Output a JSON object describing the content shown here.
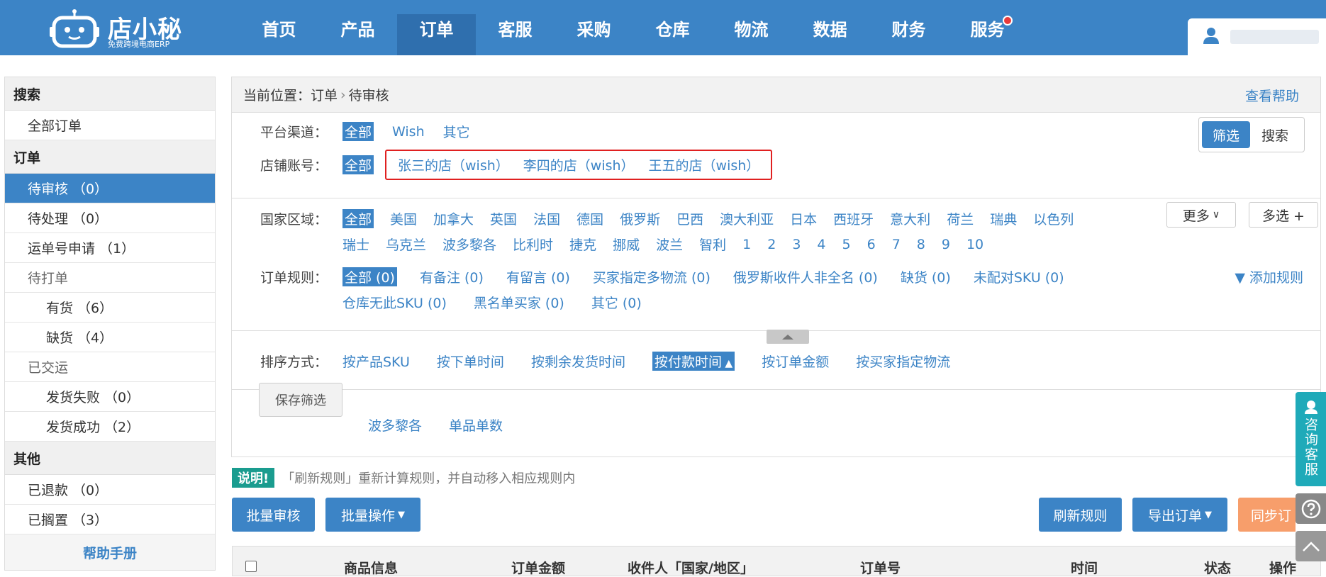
{
  "brand": {
    "name": "店小秘",
    "tagline": "免费跨境电商ERP"
  },
  "nav": {
    "items": [
      "首页",
      "产品",
      "订单",
      "客服",
      "采购",
      "仓库",
      "物流",
      "数据",
      "财务",
      "服务"
    ],
    "active_index": 2,
    "dot_on": "服务"
  },
  "sidebar": {
    "search_head": "搜索",
    "all_orders": "全部订单",
    "order_head": "订单",
    "pending_review": "待审核 （0）",
    "pending": "待处理 （0）",
    "tracking_apply": "运单号申请 （1）",
    "to_print": "待打单",
    "in_stock": "有货 （6）",
    "out_stock": "缺货 （4）",
    "shipped": "已交运",
    "ship_fail": "发货失败 （0）",
    "ship_ok": "发货成功 （2）",
    "other_head": "其他",
    "refunded": "已退款 （0）",
    "shelved": "已搁置 （3）",
    "help": "帮助手册"
  },
  "breadcrumb": {
    "prefix": "当前位置：",
    "level1": "订单",
    "sep": "›",
    "level2": "待审核",
    "help": "查看帮助"
  },
  "filters": {
    "toggle": {
      "filter": "筛选",
      "search": "搜索"
    },
    "platform": {
      "label": "平台渠道：",
      "options": [
        "全部",
        "Wish",
        "其它"
      ]
    },
    "shop": {
      "label": "店铺账号：",
      "all": "全部",
      "shops": [
        "张三的店（wish）",
        "李四的店（wish）",
        "王五的店（wish）"
      ]
    },
    "country": {
      "label": "国家区域：",
      "row1": [
        "全部",
        "美国",
        "加拿大",
        "英国",
        "法国",
        "德国",
        "俄罗斯",
        "巴西",
        "澳大利亚",
        "日本",
        "西班牙",
        "意大利",
        "荷兰",
        "瑞典",
        "以色列"
      ],
      "row2": [
        "瑞士",
        "乌克兰",
        "波多黎各",
        "比利时",
        "捷克",
        "挪威",
        "波兰",
        "智利",
        "1",
        "2",
        "3",
        "4",
        "5",
        "6",
        "7",
        "8",
        "9",
        "10"
      ],
      "more": "更多",
      "multi": "多选 +"
    },
    "rules": {
      "label": "订单规则：",
      "row1": [
        "全部 (0)",
        "有备注 (0)",
        "有留言 (0)",
        "买家指定多物流 (0)",
        "俄罗斯收件人非全名 (0)",
        "缺货 (0)",
        "未配对SKU (0)"
      ],
      "row2": [
        "仓库无此SKU (0)",
        "黑名单买家 (0)",
        "其它 (0)"
      ],
      "add": "添加规则"
    },
    "sort": {
      "label": "排序方式：",
      "options": [
        "按产品SKU",
        "按下单时间",
        "按剩余发货时间",
        "按付款时间",
        "按订单金额",
        "按买家指定物流"
      ],
      "active": "按付款时间"
    },
    "saved": {
      "save": "保存筛选",
      "presets": [
        "波多黎各",
        "单品单数"
      ]
    }
  },
  "note": {
    "badge": "说明!",
    "text": "「刷新规则」重新计算规则，并自动移入相应规则内"
  },
  "actions": {
    "batch_review": "批量审核",
    "batch_ops": "批量操作",
    "refresh": "刷新规则",
    "export": "导出订单",
    "sync": "同步订"
  },
  "table": {
    "headers": [
      "商品信息",
      "订单金额",
      "收件人「国家/地区」",
      "订单号",
      "时间",
      "状态",
      "操作"
    ]
  },
  "float": {
    "cs": "咨询客服"
  },
  "colors": {
    "primary": "#3c84c6",
    "teal": "#1faab9",
    "orange": "#f79e6b",
    "red": "#e02020"
  }
}
